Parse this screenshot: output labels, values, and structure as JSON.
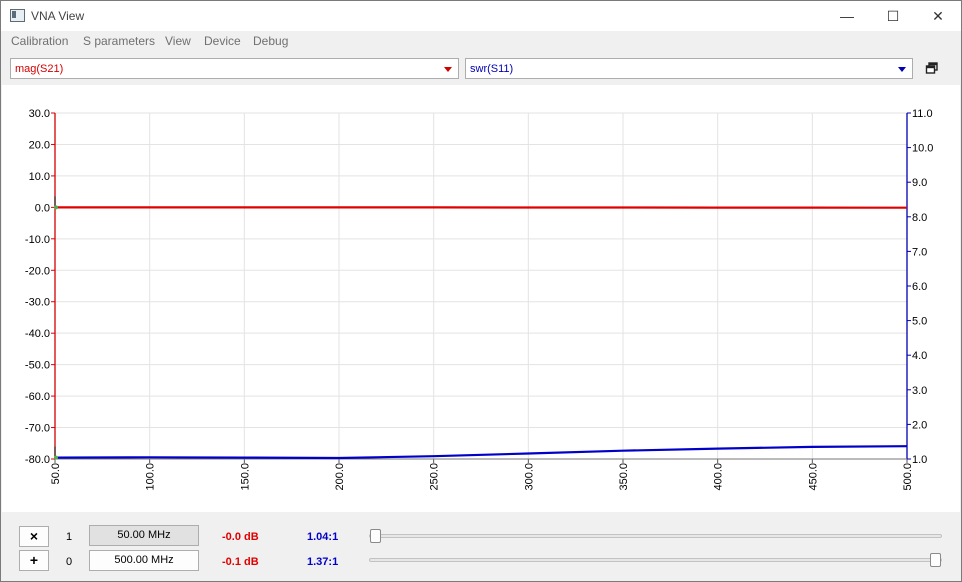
{
  "window": {
    "title": "VNA View",
    "minimize_glyph": "—",
    "maximize_glyph": "☐",
    "close_glyph": "✕"
  },
  "menu": [
    "Calibration",
    "S parameters",
    "View",
    "Device",
    "Debug"
  ],
  "trace_selectors": {
    "left": {
      "value": "mag(S21)",
      "color": "#d40000"
    },
    "right": {
      "value": "swr(S11)",
      "color": "#0000b4"
    }
  },
  "chart_data": {
    "type": "line",
    "x": [
      50,
      100,
      150,
      200,
      250,
      300,
      350,
      400,
      450,
      500
    ],
    "x_ticks": [
      "50.0",
      "100.0",
      "150.0",
      "200.0",
      "250.0",
      "300.0",
      "350.0",
      "400.0",
      "450.0",
      "500.0"
    ],
    "xlim": [
      50,
      500
    ],
    "y_left_ticks": [
      "30.0",
      "20.0",
      "10.0",
      "0.0",
      "-10.0",
      "-20.0",
      "-30.0",
      "-40.0",
      "-50.0",
      "-60.0",
      "-70.0",
      "-80.0"
    ],
    "y_left_lim": [
      -80,
      30
    ],
    "y_right_ticks": [
      "11.0",
      "10.0",
      "9.0",
      "8.0",
      "7.0",
      "6.0",
      "5.0",
      "4.0",
      "3.0",
      "2.0",
      "1.0"
    ],
    "y_right_lim": [
      1,
      11
    ],
    "grid": true,
    "series": [
      {
        "name": "mag(S21)",
        "axis": "left",
        "color": "#e00000",
        "values": [
          0.0,
          0.0,
          0.0,
          0.0,
          -0.02,
          -0.03,
          -0.05,
          -0.07,
          -0.09,
          -0.1
        ]
      },
      {
        "name": "swr(S11)",
        "axis": "right",
        "color": "#0000c8",
        "values": [
          1.04,
          1.05,
          1.04,
          1.03,
          1.08,
          1.16,
          1.24,
          1.3,
          1.35,
          1.37
        ]
      }
    ],
    "marker_x": 50
  },
  "markers": [
    {
      "button": "×",
      "index": "1",
      "frequency": "50.00 MHz",
      "mag": "-0.0 dB",
      "swr": "1.04:1",
      "slider_fraction": 0.0
    },
    {
      "button": "+",
      "index": "0",
      "frequency": "500.00 MHz",
      "mag": "-0.1 dB",
      "swr": "1.37:1",
      "slider_fraction": 1.0
    }
  ]
}
